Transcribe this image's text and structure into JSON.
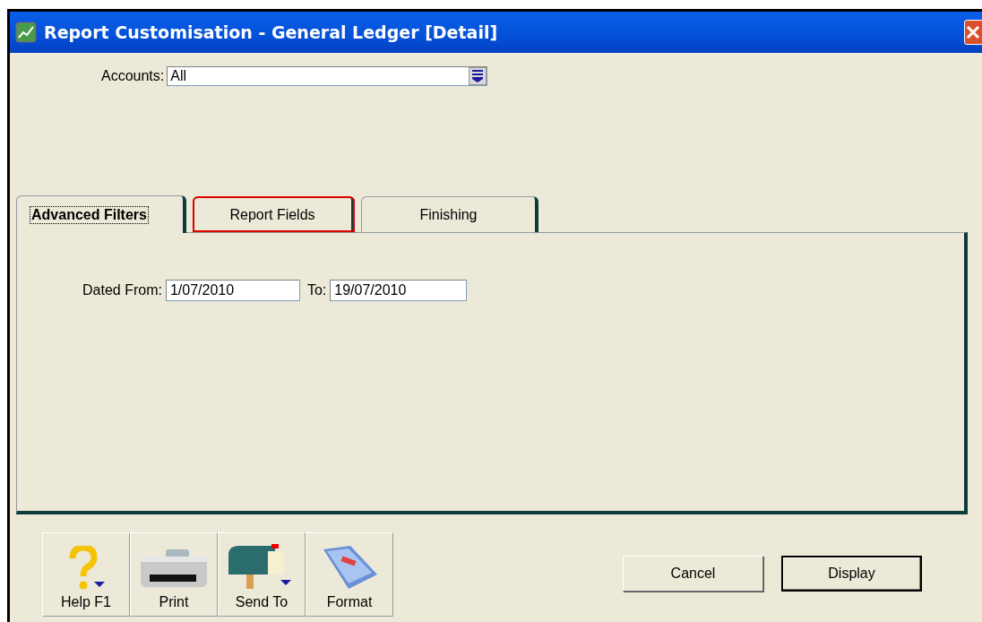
{
  "window": {
    "title": "Report Customisation - General Ledger [Detail]"
  },
  "accounts": {
    "label": "Accounts:",
    "value": "All"
  },
  "tabs": [
    {
      "label": "Advanced Filters",
      "selected": true,
      "highlighted": false
    },
    {
      "label": "Report Fields",
      "selected": false,
      "highlighted": true
    },
    {
      "label": "Finishing",
      "selected": false,
      "highlighted": false
    }
  ],
  "filters": {
    "from_label": "Dated From:",
    "from_value": "1/07/2010",
    "to_label": "To:",
    "to_value": "19/07/2010"
  },
  "toolbar": [
    {
      "kind": "help",
      "label": "Help F1"
    },
    {
      "kind": "print",
      "label": "Print"
    },
    {
      "kind": "send",
      "label": "Send To"
    },
    {
      "kind": "format",
      "label": "Format"
    }
  ],
  "buttons": [
    {
      "label": "Cancel",
      "default": false
    },
    {
      "label": "Display",
      "default": true
    }
  ]
}
